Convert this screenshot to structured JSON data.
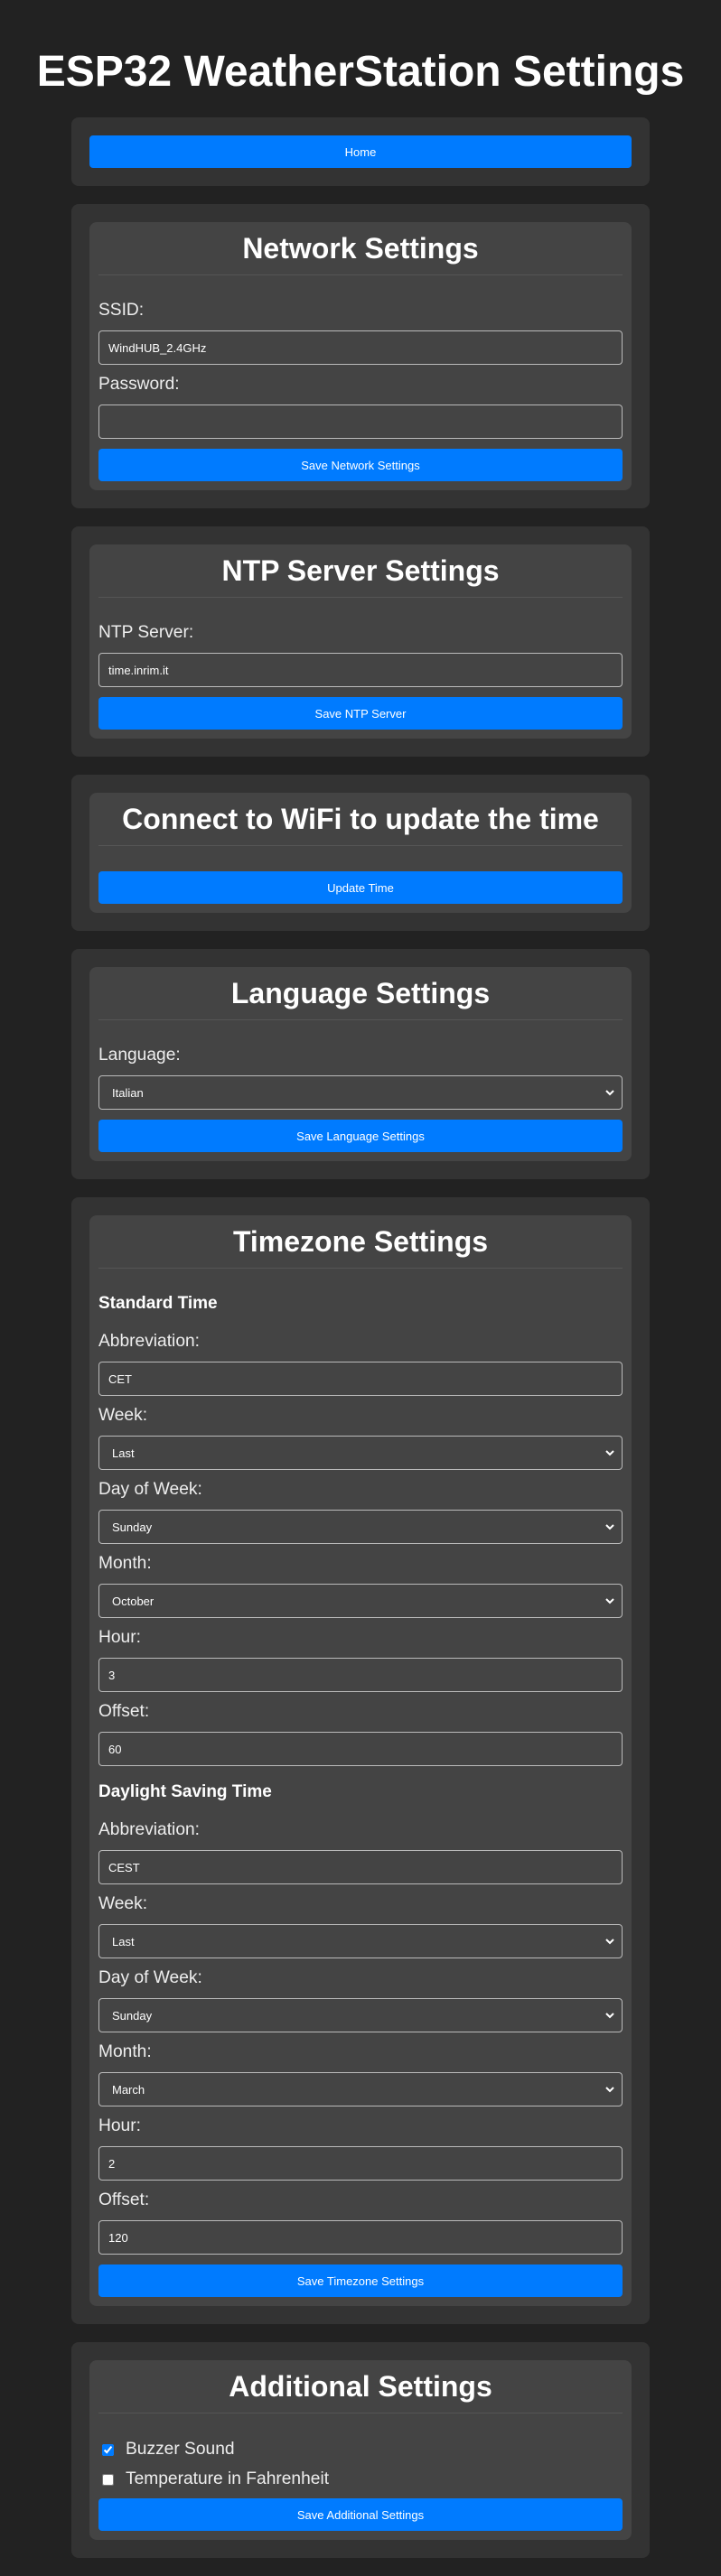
{
  "page_title": "ESP32 WeatherStation Settings",
  "home": {
    "label": "Home"
  },
  "network": {
    "title": "Network Settings",
    "ssid_label": "SSID:",
    "ssid_value": "WindHUB_2.4GHz",
    "password_label": "Password:",
    "password_value": "",
    "save_label": "Save Network Settings"
  },
  "ntp": {
    "title": "NTP Server Settings",
    "server_label": "NTP Server:",
    "server_value": "time.inrim.it",
    "save_label": "Save NTP Server"
  },
  "time_update": {
    "title": "Connect to WiFi to update the time",
    "button_label": "Update Time"
  },
  "language": {
    "title": "Language Settings",
    "label": "Language:",
    "selected": "Italian",
    "save_label": "Save Language Settings"
  },
  "timezone": {
    "title": "Timezone Settings",
    "standard": {
      "heading": "Standard Time",
      "abbr_label": "Abbreviation:",
      "abbr_value": "CET",
      "week_label": "Week:",
      "week_value": "Last",
      "dow_label": "Day of Week:",
      "dow_value": "Sunday",
      "month_label": "Month:",
      "month_value": "October",
      "hour_label": "Hour:",
      "hour_value": "3",
      "offset_label": "Offset:",
      "offset_value": "60"
    },
    "dst": {
      "heading": "Daylight Saving Time",
      "abbr_label": "Abbreviation:",
      "abbr_value": "CEST",
      "week_label": "Week:",
      "week_value": "Last",
      "dow_label": "Day of Week:",
      "dow_value": "Sunday",
      "month_label": "Month:",
      "month_value": "March",
      "hour_label": "Hour:",
      "hour_value": "2",
      "offset_label": "Offset:",
      "offset_value": "120"
    },
    "save_label": "Save Timezone Settings"
  },
  "additional": {
    "title": "Additional Settings",
    "buzzer_label": "Buzzer Sound",
    "buzzer_checked": true,
    "fahrenheit_label": "Temperature in Fahrenheit",
    "fahrenheit_checked": false,
    "save_label": "Save Additional Settings"
  },
  "colors": {
    "background": "#222222",
    "section": "#333333",
    "card": "#444444",
    "accent": "#007bff"
  }
}
